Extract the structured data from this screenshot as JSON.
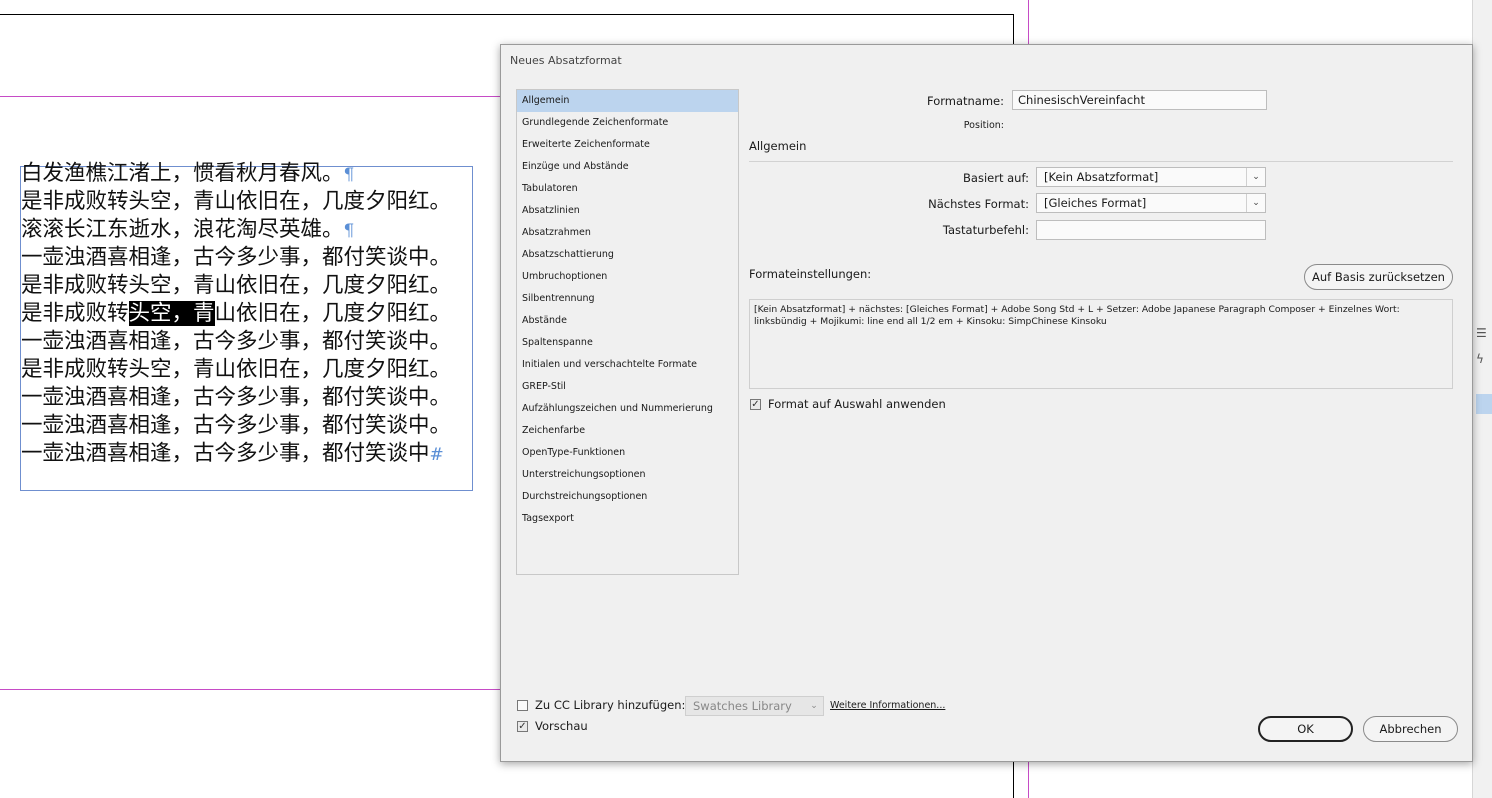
{
  "document": {
    "text_lines": [
      {
        "before": "白发渔樵江渚上，惯看秋月春风。",
        "hl": "",
        "after": "",
        "mark": "¶"
      },
      {
        "before": "是非成败转头空，青山依旧在，几度夕阳红。",
        "hl": "",
        "after": "",
        "mark": ""
      },
      {
        "before": "滚滚长江东逝水，浪花淘尽英雄。",
        "hl": "",
        "after": "",
        "mark": "¶"
      },
      {
        "before": "一壶浊酒喜相逢，古今多少事，都付笑谈中。",
        "hl": "",
        "after": "",
        "mark": ""
      },
      {
        "before": "是非成败转头空，青山依旧在，几度夕阳红。",
        "hl": "",
        "after": "",
        "mark": ""
      },
      {
        "before": "是非成败转",
        "hl": "头空，青",
        "after": "山依旧在，几度夕阳红。",
        "mark": ""
      },
      {
        "before": "一壶浊酒喜相逢，古今多少事，都付笑谈中。",
        "hl": "",
        "after": "",
        "mark": ""
      },
      {
        "before": "是非成败转头空，青山依旧在，几度夕阳红。",
        "hl": "",
        "after": "",
        "mark": ""
      },
      {
        "before": "一壶浊酒喜相逢，古今多少事，都付笑谈中。",
        "hl": "",
        "after": "",
        "mark": ""
      },
      {
        "before": "一壶浊酒喜相逢，古今多少事，都付笑谈中。",
        "hl": "",
        "after": "",
        "mark": ""
      },
      {
        "before": "一壶浊酒喜相逢，古今多少事，都付笑谈中",
        "hl": "",
        "after": "",
        "mark": "#"
      }
    ]
  },
  "dialog": {
    "title": "Neues Absatzformat",
    "nav_items": [
      "Allgemein",
      "Grundlegende Zeichenformate",
      "Erweiterte Zeichenformate",
      "Einzüge und Abstände",
      "Tabulatoren",
      "Absatzlinien",
      "Absatzrahmen",
      "Absatzschattierung",
      "Umbruchoptionen",
      "Silbentrennung",
      "Abstände",
      "Spaltenspanne",
      "Initialen und verschachtelte Formate",
      "GREP-Stil",
      "Aufzählungszeichen und Nummerierung",
      "Zeichenfarbe",
      "OpenType-Funktionen",
      "Unterstreichungsoptionen",
      "Durchstreichungsoptionen",
      "Tagsexport"
    ],
    "selected_nav": "Allgemein",
    "format_name_label": "Formatname:",
    "format_name_value": "ChinesischVereinfacht",
    "position_label": "Position:",
    "section_general": "Allgemein",
    "based_on_label": "Basiert auf:",
    "based_on_value": "[Kein Absatzformat]",
    "next_format_label": "Nächstes Format:",
    "next_format_value": "[Gleiches Format]",
    "shortcut_label": "Tastaturbefehl:",
    "shortcut_value": "",
    "settings_label": "Formateinstellungen:",
    "reset_button": "Auf Basis zurücksetzen",
    "settings_text": "[Kein Absatzformat] + nächstes: [Gleiches Format] + Adobe Song Std + L + Setzer:  Adobe Japanese Paragraph Composer + Einzelnes Wort: linksbündig + Mojikumi:  line end all 1/2 em + Kinsoku:  SimpChinese Kinsoku",
    "apply_checkbox_label": "Format auf Auswahl anwenden",
    "apply_checked": true,
    "cc_library_label": "Zu CC Library hinzufügen:",
    "cc_library_checked": false,
    "cc_library_select": "Swatches Library",
    "more_info_link": "Weitere Informationen...",
    "preview_label": "Vorschau",
    "preview_checked": true,
    "ok_button": "OK",
    "cancel_button": "Abbrechen"
  },
  "colors": {
    "guide": "#c64bc6",
    "frame": "#6f8fcf",
    "selection": "#bcd4ee"
  }
}
